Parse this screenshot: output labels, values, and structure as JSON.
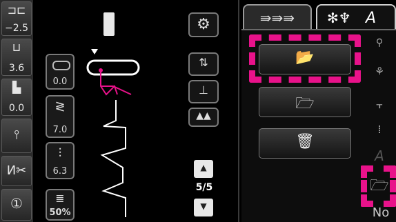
{
  "left_panel": {
    "items": [
      {
        "name": "stitch-width",
        "value": "2.5"
      },
      {
        "name": "stitch-length",
        "value": "3.6"
      },
      {
        "name": "presser-foot-pressure",
        "value": "0.0"
      },
      {
        "name": "needle-position",
        "value": ""
      },
      {
        "name": "cutter",
        "value": ""
      },
      {
        "name": "info",
        "value": ""
      }
    ]
  },
  "mid_panel": {
    "balance_value": "0.0",
    "tension_value": "7.0",
    "length_value": "6.3",
    "speed_value": "50%"
  },
  "pager": {
    "label": "5/5"
  },
  "right_panel": {
    "fav_label": "A",
    "bottom_label": "No"
  },
  "colors": {
    "accent": "#e8128a",
    "stitch": "#ffffff"
  }
}
